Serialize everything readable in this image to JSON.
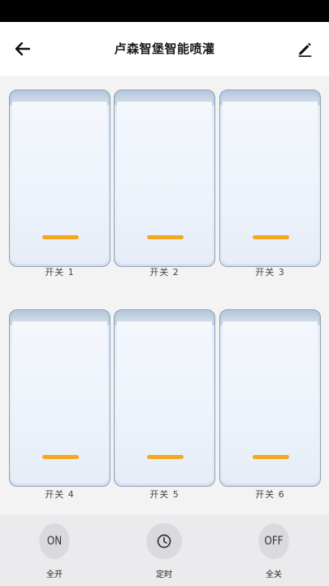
{
  "header": {
    "title": "卢森智堡智能喷灌",
    "back_icon": "arrow-left-icon",
    "edit_icon": "pencil-icon"
  },
  "switches": [
    {
      "label": "开关 1",
      "state": "off"
    },
    {
      "label": "开关 2",
      "state": "off"
    },
    {
      "label": "开关 3",
      "state": "off"
    },
    {
      "label": "开关 4",
      "state": "off"
    },
    {
      "label": "开关 5",
      "state": "off"
    },
    {
      "label": "开关 6",
      "state": "off"
    }
  ],
  "colors": {
    "indicator": "#f5a81f",
    "switch_border": "#8ea2b8",
    "bottom_bar": "#ebebed"
  },
  "bottom_bar": {
    "all_on": {
      "icon_text": "ON",
      "label": "全开"
    },
    "timer": {
      "icon": "clock-icon",
      "label": "定时"
    },
    "all_off": {
      "icon_text": "OFF",
      "label": "全关"
    }
  }
}
